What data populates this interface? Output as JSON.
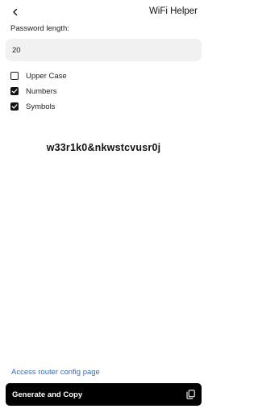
{
  "header": {
    "title": "WiFi Helper",
    "back_icon": "back-arrow-icon"
  },
  "form": {
    "password_length_label": "Password length:",
    "password_length_value": "20",
    "options": [
      {
        "label": "Upper Case",
        "checked": false
      },
      {
        "label": "Numbers",
        "checked": true
      },
      {
        "label": "Symbols",
        "checked": true
      }
    ]
  },
  "result": {
    "password": "w33r1k0&nkwstcvusr0j"
  },
  "footer": {
    "router_link": "Access router config page",
    "generate_button": "Generate and Copy",
    "copy_icon": "copy-icon"
  },
  "colors": {
    "link": "#1f6fd1",
    "button_bg": "#000000",
    "input_bg": "#f1f1f1"
  }
}
